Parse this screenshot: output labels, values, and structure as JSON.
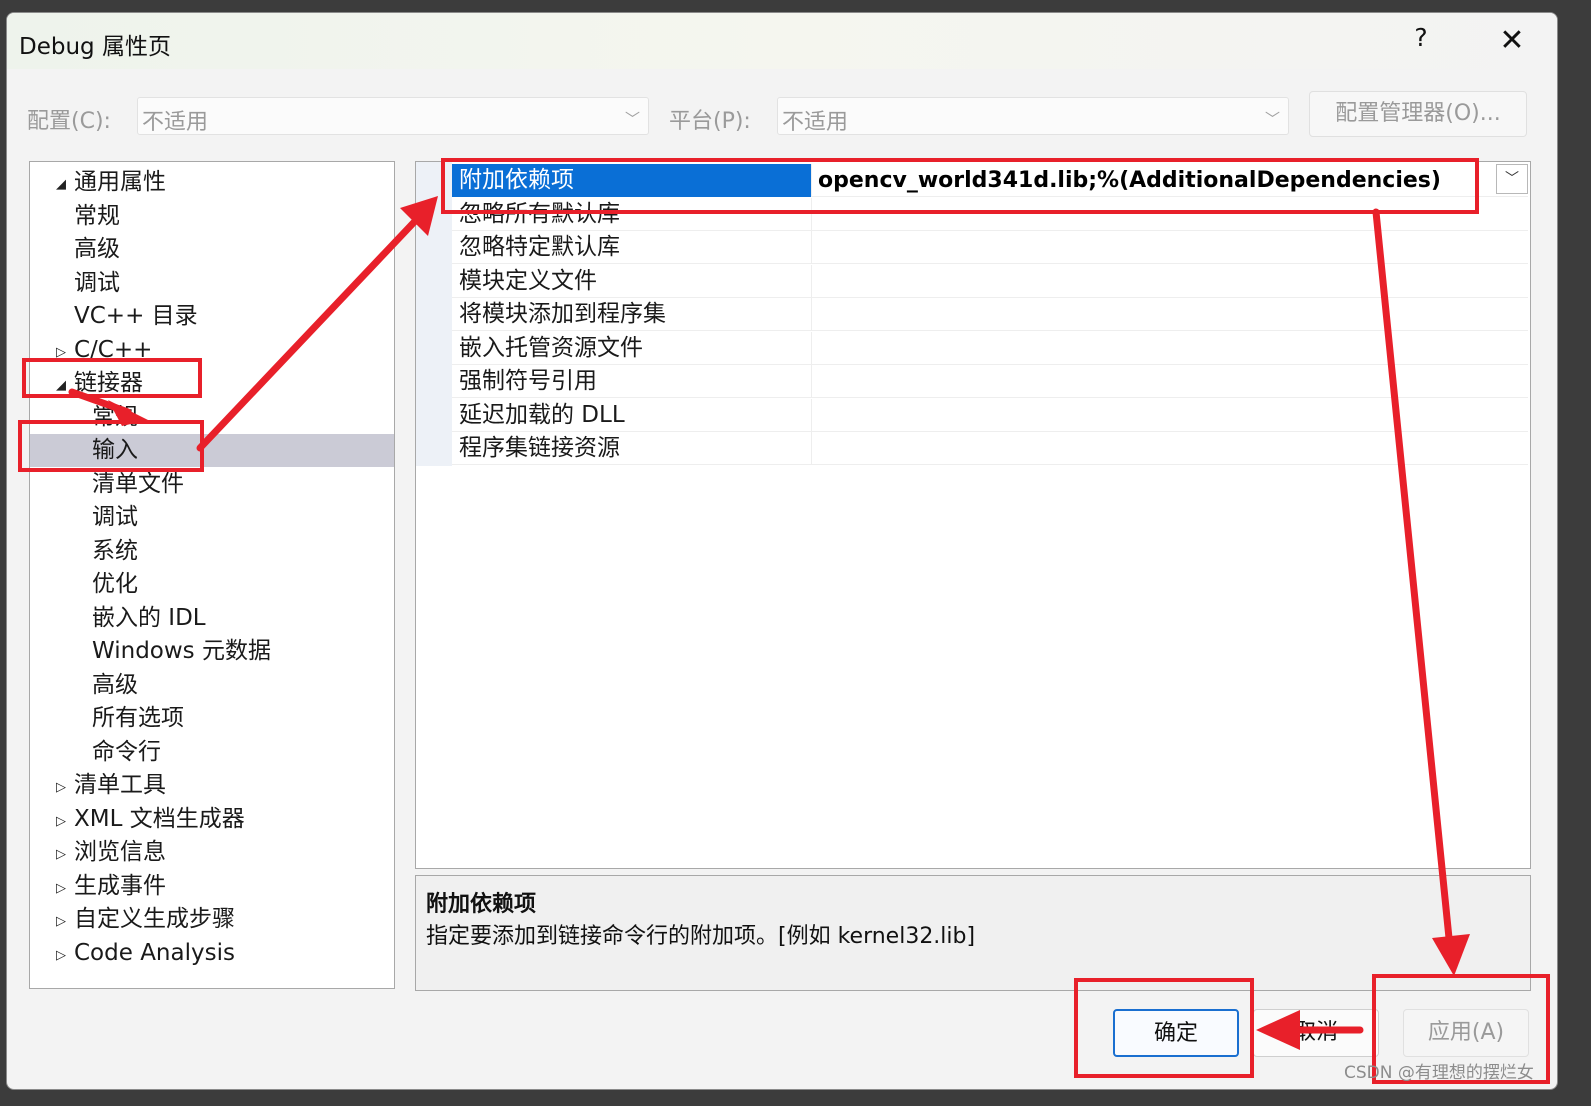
{
  "window": {
    "title": "Debug 属性页",
    "help_glyph": "?",
    "close_glyph": "✕"
  },
  "config_bar": {
    "config_label": "配置(C):",
    "config_value": "不适用",
    "platform_label": "平台(P):",
    "platform_value": "不适用",
    "manager_button": "配置管理器(O)..."
  },
  "tree": {
    "items": [
      {
        "label": "通用属性",
        "twisty": "◢"
      },
      {
        "label": "常规",
        "twisty": ""
      },
      {
        "label": "高级",
        "twisty": ""
      },
      {
        "label": "调试",
        "twisty": ""
      },
      {
        "label": "VC++ 目录",
        "twisty": ""
      },
      {
        "label": "C/C++",
        "twisty": "▷"
      },
      {
        "label": "链接器",
        "twisty": "◢"
      },
      {
        "label": "常规",
        "twisty": ""
      },
      {
        "label": "输入",
        "twisty": "",
        "selected": true
      },
      {
        "label": "清单文件",
        "twisty": ""
      },
      {
        "label": "调试",
        "twisty": ""
      },
      {
        "label": "系统",
        "twisty": ""
      },
      {
        "label": "优化",
        "twisty": ""
      },
      {
        "label": "嵌入的 IDL",
        "twisty": ""
      },
      {
        "label": "Windows 元数据",
        "twisty": ""
      },
      {
        "label": "高级",
        "twisty": ""
      },
      {
        "label": "所有选项",
        "twisty": ""
      },
      {
        "label": "命令行",
        "twisty": ""
      },
      {
        "label": "清单工具",
        "twisty": "▷"
      },
      {
        "label": "XML 文档生成器",
        "twisty": "▷"
      },
      {
        "label": "浏览信息",
        "twisty": "▷"
      },
      {
        "label": "生成事件",
        "twisty": "▷"
      },
      {
        "label": "自定义生成步骤",
        "twisty": "▷"
      },
      {
        "label": "Code Analysis",
        "twisty": "▷"
      }
    ]
  },
  "grid": {
    "rows": [
      {
        "name": "附加依赖项",
        "value": "opencv_world341d.lib;%(AdditionalDependencies)",
        "selected": true
      },
      {
        "name": "忽略所有默认库",
        "value": ""
      },
      {
        "name": "忽略特定默认库",
        "value": ""
      },
      {
        "name": "模块定义文件",
        "value": ""
      },
      {
        "name": "将模块添加到程序集",
        "value": ""
      },
      {
        "name": "嵌入托管资源文件",
        "value": ""
      },
      {
        "name": "强制符号引用",
        "value": ""
      },
      {
        "name": "延迟加载的 DLL",
        "value": ""
      },
      {
        "name": "程序集链接资源",
        "value": ""
      }
    ],
    "dropdown_glyph": "﹀"
  },
  "description": {
    "title": "附加依赖项",
    "text": "指定要添加到链接命令行的附加项。[例如 kernel32.lib]"
  },
  "buttons": {
    "ok": "确定",
    "cancel": "取消",
    "apply": "应用(A)"
  },
  "watermark": "CSDN @有理想的摆烂女",
  "colors": {
    "annotation_red": "#e8202a",
    "selection_blue": "#0a6fd6",
    "tree_selection": "#cbcbd6"
  }
}
